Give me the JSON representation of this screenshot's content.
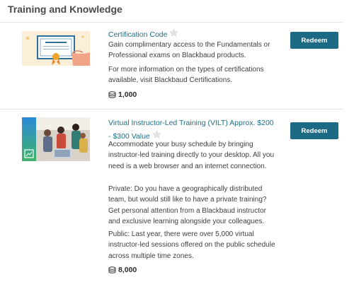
{
  "section": {
    "title": "Training and Knowledge"
  },
  "items": [
    {
      "title": "Certification Code",
      "paragraphs": [
        "Gain complimentary access to the Fundamentals or Professional exams on Blackbaud products.",
        "For more information on the types of certifications available, visit Blackbaud Certifications."
      ],
      "points": "1,000",
      "button_label": "Redeem",
      "icons": {
        "favorite": "star-icon",
        "points": "coin-stack-icon"
      }
    },
    {
      "title_line1": "Virtual Instructor-Led Training (VILT) Approx. $200",
      "title_line2": "- $300 Value",
      "paragraphs": [
        "Accommodate your busy schedule by bringing instructor-led training directly to your desktop. All you need is a web browser and an internet connection.",
        "Private: Do you have a geographically distributed team, but would still like to have a private training? Get personal attention from a Blackbaud instructor and exclusive learning alongside your colleagues.",
        "Public: Last year, there were over 5,000 virtual instructor-led sessions offered on the public schedule across multiple time zones."
      ],
      "points": "8,000",
      "button_label": "Redeem",
      "icons": {
        "favorite": "star-icon",
        "points": "coin-stack-icon"
      }
    }
  ],
  "colors": {
    "accent": "#1d6a84",
    "link": "#1d6f86"
  }
}
